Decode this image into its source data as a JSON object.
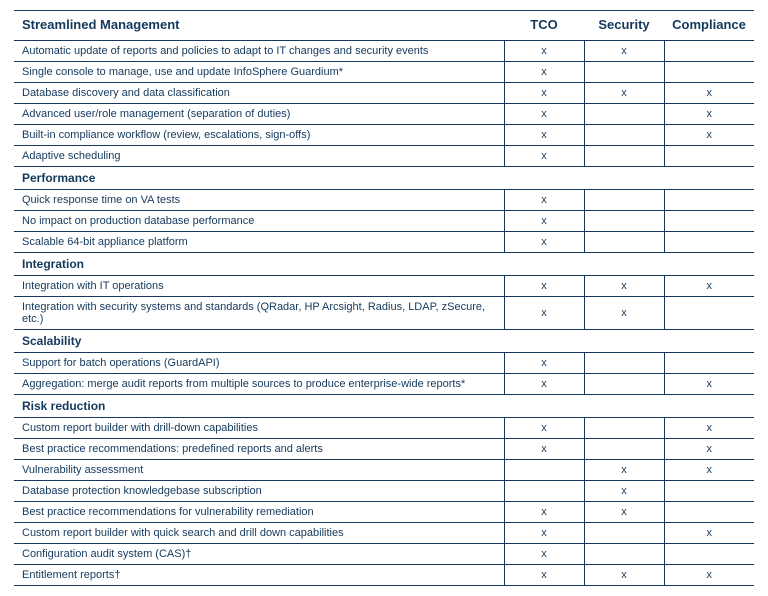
{
  "chart_data": {
    "type": "table",
    "columns": [
      "Streamlined Management",
      "TCO",
      "Security",
      "Compliance"
    ],
    "sections": [
      {
        "name": null,
        "rows": [
          {
            "feature": "Automatic update of reports and policies to adapt to IT changes and security events",
            "tco": "x",
            "security": "x",
            "compliance": ""
          },
          {
            "feature": "Single console to manage, use and update InfoSphere Guardium*",
            "tco": "x",
            "security": "",
            "compliance": ""
          },
          {
            "feature": "Database discovery and data classification",
            "tco": "x",
            "security": "x",
            "compliance": "x"
          },
          {
            "feature": "Advanced user/role management (separation of duties)",
            "tco": "x",
            "security": "",
            "compliance": "x"
          },
          {
            "feature": "Built-in compliance workflow (review, escalations, sign-offs)",
            "tco": "x",
            "security": "",
            "compliance": "x"
          },
          {
            "feature": "Adaptive scheduling",
            "tco": "x",
            "security": "",
            "compliance": ""
          }
        ]
      },
      {
        "name": "Performance",
        "rows": [
          {
            "feature": "Quick response time on VA tests",
            "tco": "x",
            "security": "",
            "compliance": ""
          },
          {
            "feature": "No impact on production database performance",
            "tco": "x",
            "security": "",
            "compliance": ""
          },
          {
            "feature": "Scalable 64-bit appliance platform",
            "tco": "x",
            "security": "",
            "compliance": ""
          }
        ]
      },
      {
        "name": "Integration",
        "rows": [
          {
            "feature": "Integration with IT operations",
            "tco": "x",
            "security": "x",
            "compliance": "x"
          },
          {
            "feature": "Integration with security systems and standards (QRadar, HP Arcsight, Radius, LDAP, zSecure, etc.)",
            "tco": "x",
            "security": "x",
            "compliance": ""
          }
        ]
      },
      {
        "name": "Scalability",
        "rows": [
          {
            "feature": "Support for batch operations (GuardAPI)",
            "tco": "x",
            "security": "",
            "compliance": ""
          },
          {
            "feature": "Aggregation: merge audit reports from multiple sources to produce enterprise-wide reports*",
            "tco": "x",
            "security": "",
            "compliance": "x"
          }
        ]
      },
      {
        "name": "Risk reduction",
        "rows": [
          {
            "feature": "Custom report builder with drill-down capabilities",
            "tco": "x",
            "security": "",
            "compliance": "x"
          },
          {
            "feature": "Best practice recommendations: predefined reports and alerts",
            "tco": "x",
            "security": "",
            "compliance": "x"
          },
          {
            "feature": "Vulnerability assessment",
            "tco": "",
            "security": "x",
            "compliance": "x"
          },
          {
            "feature": "Database protection knowledgebase subscription",
            "tco": "",
            "security": "x",
            "compliance": ""
          },
          {
            "feature": "Best practice recommendations for vulnerability remediation",
            "tco": "x",
            "security": "x",
            "compliance": ""
          },
          {
            "feature": "Custom report builder with quick search and drill down capabilities",
            "tco": "x",
            "security": "",
            "compliance": "x"
          },
          {
            "feature": "Configuration audit system (CAS)†",
            "tco": "x",
            "security": "",
            "compliance": ""
          },
          {
            "feature": "Entitlement reports†",
            "tco": "x",
            "security": "x",
            "compliance": "x"
          }
        ]
      }
    ]
  }
}
